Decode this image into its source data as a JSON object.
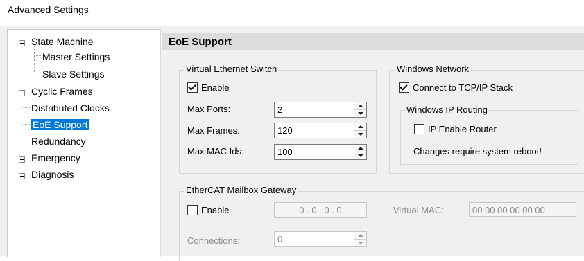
{
  "window": {
    "title": "Advanced Settings"
  },
  "tree": {
    "items": [
      {
        "label": "State Machine",
        "expander": "minus"
      },
      {
        "label": "Master Settings"
      },
      {
        "label": "Slave Settings"
      },
      {
        "label": "Cyclic Frames",
        "expander": "plus"
      },
      {
        "label": "Distributed Clocks"
      },
      {
        "label": "EoE Support",
        "selected": true
      },
      {
        "label": "Redundancy"
      },
      {
        "label": "Emergency",
        "expander": "plus"
      },
      {
        "label": "Diagnosis",
        "expander": "plus"
      }
    ]
  },
  "panel": {
    "header": "EoE Support",
    "virtual_switch": {
      "legend": "Virtual Ethernet Switch",
      "enable_label": "Enable",
      "enable_checked": true,
      "max_ports_label": "Max Ports:",
      "max_ports_value": "2",
      "max_frames_label": "Max Frames:",
      "max_frames_value": "120",
      "max_mac_label": "Max MAC Ids:",
      "max_mac_value": "100"
    },
    "windows_network": {
      "legend": "Windows Network",
      "connect_label": "Connect to TCP/IP Stack",
      "connect_checked": true,
      "ip_routing": {
        "legend": "Windows IP Routing",
        "ip_enable_label": "IP Enable Router",
        "ip_enable_checked": false,
        "note": "Changes require system reboot!"
      }
    },
    "mailbox_gateway": {
      "legend": "EtherCAT Mailbox Gateway",
      "enable_label": "Enable",
      "enable_checked": false,
      "ip_address": "0 . 0 . 0 . 0",
      "virtual_mac_label": "Virtual MAC:",
      "virtual_mac_value": "00 00 00 00 00 00",
      "connections_label": "Connections:",
      "connections_value": "0"
    }
  }
}
